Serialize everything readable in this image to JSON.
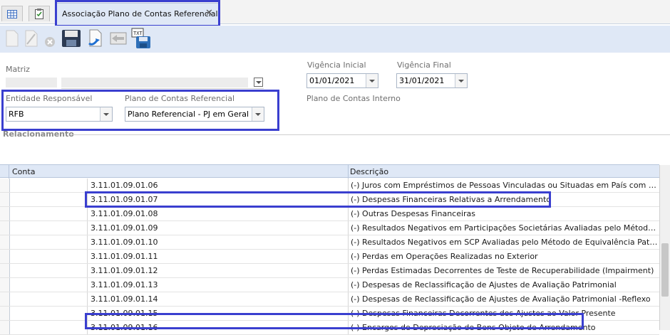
{
  "tabs": {
    "active_title": "Associação Plano de Contas Referencial",
    "close_glyph": "✕",
    "icon_tabs": [
      "grid-icon",
      "clipboard-icon"
    ]
  },
  "toolbar": {
    "buttons": [
      "new-document-icon",
      "edit-icon",
      "delete-icon",
      "save-icon",
      "import-icon",
      "export-icon",
      "save-txt-icon"
    ]
  },
  "form": {
    "matriz_label": "Matriz",
    "vigencia_inicial_label": "Vigência Inicial",
    "vigencia_inicial_value": "01/01/2021",
    "vigencia_final_label": "Vigência Final",
    "vigencia_final_value": "31/01/2021",
    "entidade_label": "Entidade Responsável",
    "entidade_value": "RFB",
    "plano_label": "Plano de Contas Referencial",
    "plano_value": "Plano Referencial - PJ em Geral",
    "plano_interno_label": "Plano de Contas Interno",
    "relacionamento_label": "Relacionamento"
  },
  "grid": {
    "columns": [
      "Conta",
      "Descrição"
    ],
    "rows": [
      {
        "code": "3.11.01.09.01.06",
        "desc": "(-) Juros com Empréstimos de Pessoas Vinculadas ou Situadas em País com Tributação Favorecida"
      },
      {
        "code": "3.11.01.09.01.07",
        "desc": "(-) Despesas Financeiras Relativas a Arrendamento"
      },
      {
        "code": "3.11.01.09.01.08",
        "desc": "(-) Outras Despesas Financeiras"
      },
      {
        "code": "3.11.01.09.01.09",
        "desc": "(-) Resultados Negativos em Participações Societárias Avaliadas pelo Método de Equivalência Patrimonial"
      },
      {
        "code": "3.11.01.09.01.10",
        "desc": "(-) Resultados Negativos em SCP Avaliadas pelo Método de Equivalência Patrimonial"
      },
      {
        "code": "3.11.01.09.01.11",
        "desc": "(-) Perdas em Operações Realizadas no Exterior"
      },
      {
        "code": "3.11.01.09.01.12",
        "desc": "(-) Perdas Estimadas Decorrentes de Teste de Recuperabilidade (Impairment)"
      },
      {
        "code": "3.11.01.09.01.13",
        "desc": "(-) Despesas de Reclassificação de Ajustes de Avaliação Patrimonial"
      },
      {
        "code": "3.11.01.09.01.14",
        "desc": "(-) Despesas de Reclassificação de Ajustes de Avaliação Patrimonial -Reflexo"
      },
      {
        "code": "3.11.01.09.01.15",
        "desc": "(-) Despesas Financeiras Decorrentes dos Ajustes ao Valor Presente"
      },
      {
        "code": "3.11.01.09.01.16",
        "desc": "(-) Encargos de Depreciação de Bens Objeto de Arrendamento"
      }
    ]
  },
  "colors": {
    "highlight": "#3a3fcf",
    "panel": "#dfe8f6"
  }
}
